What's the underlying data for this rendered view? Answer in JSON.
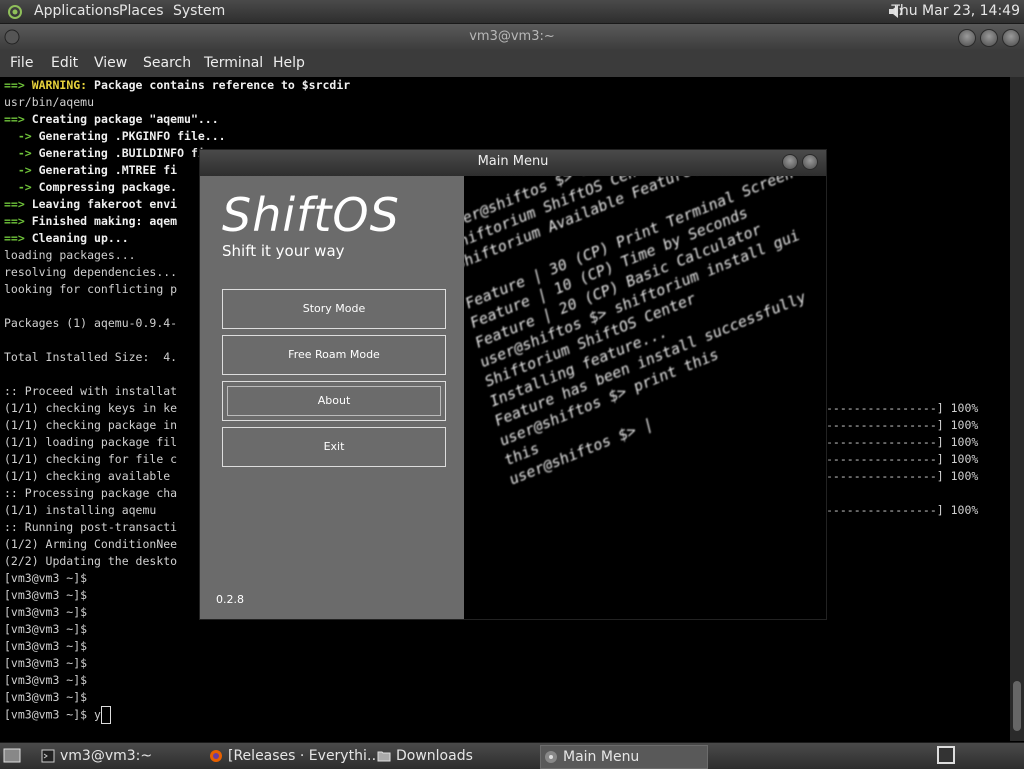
{
  "top_panel": {
    "menus": [
      "Applications",
      "Places",
      "System"
    ],
    "clock": "Thu Mar 23, 14:49"
  },
  "terminal": {
    "title": "vm3@vm3:~",
    "menubar": [
      "File",
      "Edit",
      "View",
      "Search",
      "Terminal",
      "Help"
    ],
    "lines": [
      {
        "prefix": "==> ",
        "warn": "WARNING:",
        "text": " Package contains reference to $srcdir"
      },
      {
        "text": "usr/bin/aqemu"
      },
      {
        "prefix": "==> ",
        "bold": "Creating package \"aqemu\"..."
      },
      {
        "prefix": "  -> ",
        "bold": "Generating .PKGINFO file..."
      },
      {
        "prefix": "  -> ",
        "bold": "Generating .BUILDINFO fi"
      },
      {
        "prefix": "  -> ",
        "bold": "Generating .MTREE fi"
      },
      {
        "prefix": "  -> ",
        "bold": "Compressing package."
      },
      {
        "prefix": "==> ",
        "bold": "Leaving fakeroot envi"
      },
      {
        "prefix": "==> ",
        "bold": "Finished making: aqem"
      },
      {
        "prefix": "==> ",
        "bold": "Cleaning up..."
      },
      {
        "text": "loading packages..."
      },
      {
        "text": "resolving dependencies..."
      },
      {
        "text": "looking for conflicting p"
      },
      {
        "text": ""
      },
      {
        "text": "Packages (1) aqemu-0.9.4-"
      },
      {
        "text": ""
      },
      {
        "text": "Total Installed Size:  4."
      },
      {
        "text": ""
      },
      {
        "text": ":: Proceed with installat"
      },
      {
        "text": "(1/1) checking keys in ke"
      },
      {
        "text": "(1/1) checking package in"
      },
      {
        "text": "(1/1) loading package fil"
      },
      {
        "text": "(1/1) checking for file c"
      },
      {
        "text": "(1/1) checking available"
      },
      {
        "text": ":: Processing package cha"
      },
      {
        "text": "(1/1) installing aqemu"
      },
      {
        "text": ":: Running post-transacti"
      },
      {
        "text": "(1/2) Arming ConditionNee"
      },
      {
        "text": "(2/2) Updating the deskto"
      },
      {
        "text": "[vm3@vm3 ~]$"
      },
      {
        "text": "[vm3@vm3 ~]$"
      },
      {
        "text": "[vm3@vm3 ~]$"
      },
      {
        "text": "[vm3@vm3 ~]$"
      },
      {
        "text": "[vm3@vm3 ~]$"
      },
      {
        "text": "[vm3@vm3 ~]$"
      },
      {
        "text": "[vm3@vm3 ~]$"
      },
      {
        "text": "[vm3@vm3 ~]$"
      }
    ],
    "prompt_last": "[vm3@vm3 ~]$ y",
    "progress_bar": "----------------] 100%"
  },
  "shiftos": {
    "title": "Main Menu",
    "logo": "ShiftOS",
    "tagline": "Shift it your way",
    "buttons": [
      "Story Mode",
      "Free Roam Mode",
      "About",
      "Exit"
    ],
    "version": "0.2.8",
    "preview_lines": [
      "user@shiftos $> shiftorium list",
      "Shiftorium ShiftOS Center",
      "Shiftorium Available Feature(s)",
      "",
      "Feature | 30 (CP) Print Terminal Screen",
      "Feature | 10 (CP) Time by Seconds",
      "Feature | 20 (CP) Basic Calculator",
      "user@shiftos $> shiftorium install gui",
      "Shiftorium ShiftOS Center",
      "Installing feature...",
      "Feature has been install successfully",
      "user@shiftos $> print this",
      "this",
      "user@shiftos $> |"
    ]
  },
  "bottom_panel": {
    "tasks": [
      "vm3@vm3:~",
      "[Releases · Everythi…",
      "Downloads",
      "Main Menu"
    ]
  }
}
